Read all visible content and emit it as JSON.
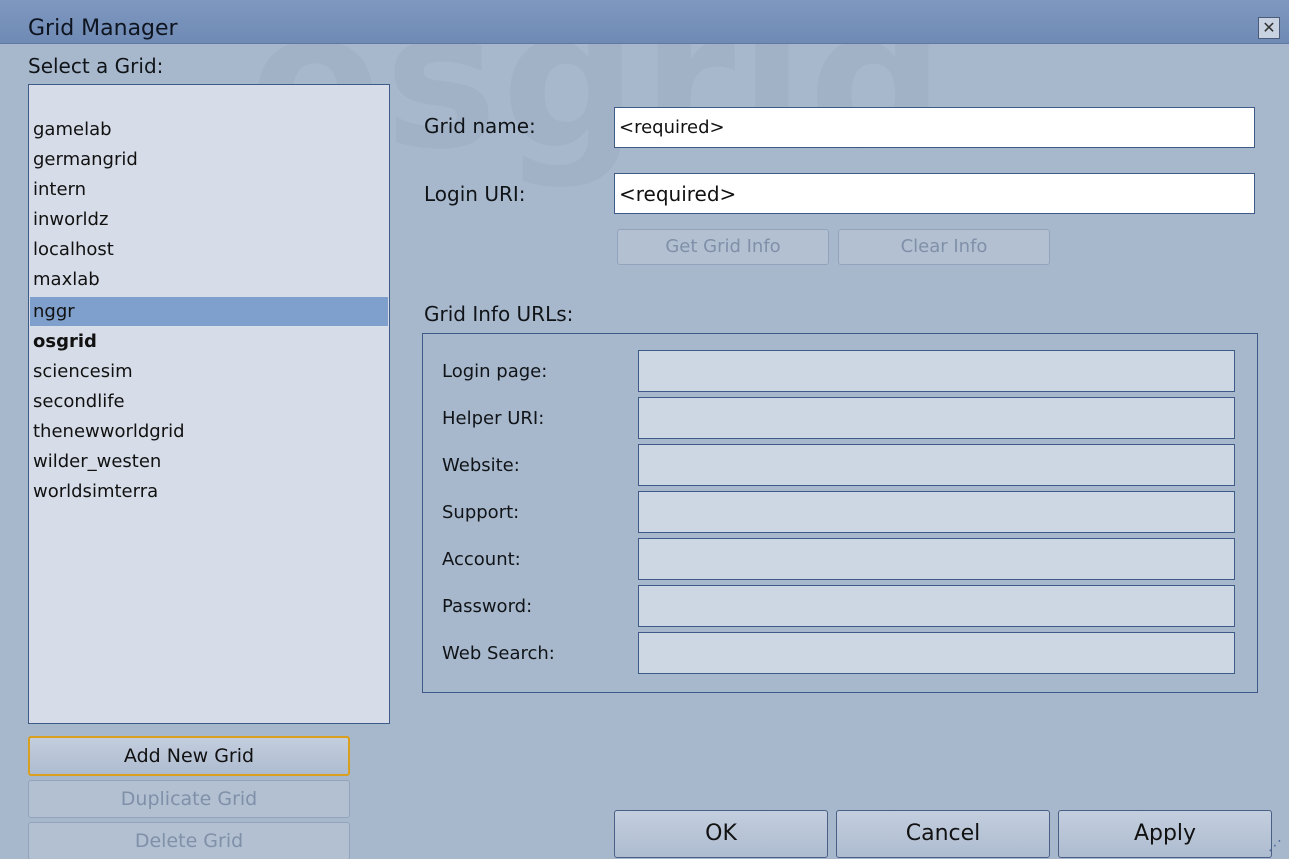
{
  "window": {
    "title": "Grid Manager",
    "close_glyph": "✕",
    "watermark": "osgrid"
  },
  "left": {
    "select_label": "Select a Grid:",
    "grids": [
      {
        "name": "gamelab",
        "selected": false,
        "bold": false
      },
      {
        "name": "germangrid",
        "selected": false,
        "bold": false
      },
      {
        "name": "intern",
        "selected": false,
        "bold": false
      },
      {
        "name": "inworldz",
        "selected": false,
        "bold": false
      },
      {
        "name": "localhost",
        "selected": false,
        "bold": false
      },
      {
        "name": "maxlab",
        "selected": false,
        "bold": false
      },
      {
        "name": "nggr",
        "selected": true,
        "bold": false
      },
      {
        "name": "osgrid",
        "selected": false,
        "bold": true
      },
      {
        "name": "sciencesim",
        "selected": false,
        "bold": false
      },
      {
        "name": "secondlife",
        "selected": false,
        "bold": false
      },
      {
        "name": "thenewworldgrid",
        "selected": false,
        "bold": false
      },
      {
        "name": "wilder_westen",
        "selected": false,
        "bold": false
      },
      {
        "name": "worldsimterra",
        "selected": false,
        "bold": false
      }
    ],
    "add_label": "Add New Grid",
    "duplicate_label": "Duplicate Grid",
    "delete_label": "Delete Grid"
  },
  "form": {
    "grid_name_label": "Grid name:",
    "grid_name_value": "<required>",
    "login_uri_label": "Login URI:",
    "login_uri_value": "<required>",
    "get_info_label": "Get Grid Info",
    "clear_info_label": "Clear Info"
  },
  "info": {
    "heading": "Grid Info URLs:",
    "fields": [
      {
        "label": "Login page:",
        "value": ""
      },
      {
        "label": "Helper URI:",
        "value": ""
      },
      {
        "label": "Website:",
        "value": ""
      },
      {
        "label": "Support:",
        "value": ""
      },
      {
        "label": "Account:",
        "value": ""
      },
      {
        "label": "Password:",
        "value": ""
      },
      {
        "label": "Web Search:",
        "value": ""
      }
    ]
  },
  "footer": {
    "ok_label": "OK",
    "cancel_label": "Cancel",
    "apply_label": "Apply",
    "resize_glyph": "⋰"
  },
  "colors": {
    "titlebar": "#7e98c0",
    "selection": "#7fa0cc",
    "focus_outline": "#d9a020"
  }
}
